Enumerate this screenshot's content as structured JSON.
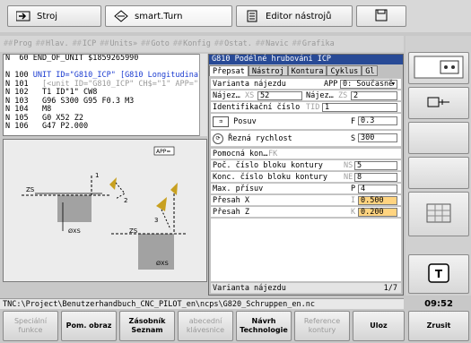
{
  "tabs": [
    "Stroj",
    "smart.Turn",
    "Editor nástrojů"
  ],
  "menu": [
    "Prog",
    "Hlav.",
    "ICP",
    "Units»",
    "Goto",
    "Konfig",
    "Ostat.",
    "Navic",
    "Grafika"
  ],
  "code": [
    {
      "n": "N  60",
      "t": "END_OF_UNIT $1859265990"
    },
    {
      "n": "",
      "t": ""
    },
    {
      "n": "N 100",
      "t": "UNIT ID=\"G810_ICP\" [G810 Longitudinal"
    },
    {
      "n": "N 101",
      "t": "  [<unit ID=\"G810_ICP\" CH$=\"1\" APP=\""
    },
    {
      "n": "N 102",
      "t": "  T1 ID\"1\" CW8"
    },
    {
      "n": "N 103",
      "t": "  G96 S300 G95 F0.3 M3"
    },
    {
      "n": "N 104",
      "t": "  M8"
    },
    {
      "n": "N 105",
      "t": "  G0 X52 Z2"
    },
    {
      "n": "N 106",
      "t": "  G47 P2.000"
    }
  ],
  "dialog": {
    "title": "G810 Podélné hrubování ICP",
    "tabs": [
      "Přepsat",
      "Nástroj",
      "Kontura",
      "Cyklus",
      "Gl"
    ],
    "variant_label": "Varianta nájezdu",
    "variant_key": "APP",
    "variant_value": "0: Současně",
    "najezd_x_label": "Nájez…",
    "najezd_x_key": "XS",
    "najezd_x": "52",
    "najezd_z_label": "Nájez…",
    "najezd_z_key": "ZS",
    "najezd_z": "2",
    "id_label": "Identifikační číslo",
    "id_key": "TID",
    "id_value": "1",
    "posuv_label": "Posuv",
    "posuv_key": "F",
    "posuv_value": "0.3",
    "rychlost_label": "Řezná rychlost",
    "rychlost_key": "S",
    "rychlost_value": "300",
    "pomocna_label": "Pomocná kon…",
    "pomocna_key": "FK",
    "start_label": "Poč. číslo bloku kontury",
    "start_key": "NS",
    "start_value": "5",
    "end_label": "Konc. číslo bloku kontury",
    "end_key": "NE",
    "end_value": "8",
    "max_label": "Max. přísuv",
    "max_key": "P",
    "max_value": "4",
    "presah_x_label": "Přesah X",
    "presah_x_key": "I",
    "presah_x_value": "0.500",
    "presah_z_label": "Přesah Z",
    "presah_z_key": "K",
    "presah_z_value": "0.200",
    "footer_label": "Varianta nájezdu",
    "footer_page": "1/7"
  },
  "graphic": {
    "app_label": "APP=",
    "labels": [
      "ZS",
      "1",
      "2",
      "ØXS",
      "ZS",
      "3",
      "ØXS"
    ]
  },
  "status": "TNC:\\Project\\Benutzerhandbuch_CNC_PILOT_en\\ncps\\G820_Schruppen_en.nc",
  "clock": "09:52",
  "softkeys": [
    "Speciální funkce",
    "Pom. obraz",
    "Zásobník Seznam",
    "abecední klávesnice",
    "Návrh Technologie",
    "Reference kontury",
    "Uloz",
    "Zrusit"
  ]
}
